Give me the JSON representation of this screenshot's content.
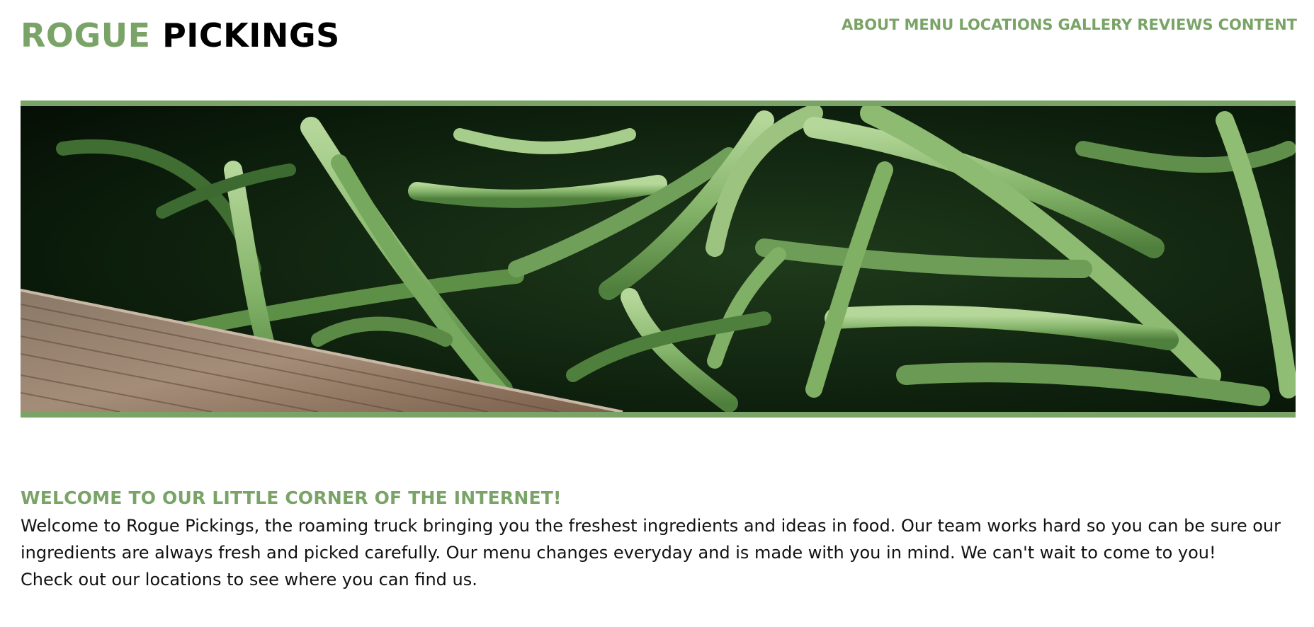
{
  "header": {
    "logo_part1": "ROGUE",
    "logo_part2": "PICKINGS",
    "nav": [
      "ABOUT",
      "MENU",
      "LOCATIONS",
      "GALLERY",
      "REVIEWS",
      "CONTENT"
    ]
  },
  "hero": {
    "image": "green-beans-photo"
  },
  "welcome": {
    "heading": "WELCOME TO OUR LITTLE CORNER OF THE INTERNET!",
    "paragraph1": "Welcome to Rogue Pickings, the roaming truck bringing you the freshest ingredients and ideas in food. Our team works hard so you can be sure our ingredients are always fresh and picked carefully. Our menu changes everyday and is made with you in mind. We can't wait to come to you!",
    "paragraph2": "Check out our locations to see where you can find us."
  },
  "colors": {
    "accent": "#7aa467",
    "text": "#000000"
  }
}
